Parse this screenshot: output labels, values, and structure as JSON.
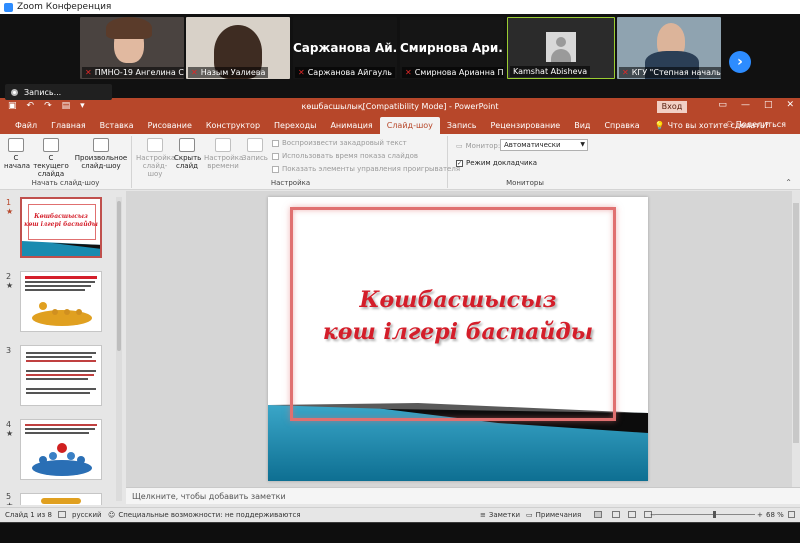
{
  "zoom": {
    "title": "Zoom Конференция",
    "recording_label": "Запись...",
    "participants": [
      {
        "name": "ПМНО-19 Ангелина С..."
      },
      {
        "name": "Назым Уалиева"
      },
      {
        "name": "Саржанова Айгауль",
        "display": "Саржанова Ай..."
      },
      {
        "name": "Смирнова Арианна П...",
        "display": "Смирнова Ари..."
      },
      {
        "name": "Kamshat Abisheva"
      },
      {
        "name": "КГУ \"Степная началь..."
      }
    ]
  },
  "ppt": {
    "doc_title": "көшбасшылық[Compatibility Mode]  -  PowerPoint",
    "login": "Вход",
    "tabs": [
      "Файл",
      "Главная",
      "Вставка",
      "Рисование",
      "Конструктор",
      "Переходы",
      "Анимация",
      "Слайд-шоу",
      "Запись",
      "Рецензирование",
      "Вид",
      "Справка"
    ],
    "tell_me": "Что вы хотите сделать?",
    "share": "Поделиться",
    "ribbon": {
      "from_start": "С начала",
      "from_current": "С текущего слайда",
      "custom": "Произвольное слайд-шоу",
      "group_start": "Начать слайд-шоу",
      "setup_show": "Настройка слайд-шоу",
      "hide_slide": "Скрыть слайд",
      "rehearse": "Настройка времени",
      "record": "Запись",
      "play_narrations": "Воспроизвести закадровый текст",
      "use_timings": "Использовать время показа слайдов",
      "show_media_controls": "Показать элементы управления проигрывателя",
      "group_setup": "Настройка",
      "monitor_label": "Монитор:",
      "monitor_value": "Автоматически",
      "presenter_view": "Режим докладчика",
      "group_monitors": "Мониторы"
    },
    "slides": [
      {
        "num": "1",
        "star": "★"
      },
      {
        "num": "2",
        "star": "★"
      },
      {
        "num": "3",
        "star": ""
      },
      {
        "num": "4",
        "star": "★"
      },
      {
        "num": "5",
        "star": "★"
      }
    ],
    "slide_title_line1": "Көшбасшысыз",
    "slide_title_line2": "көш ілгері баспайды",
    "notes_placeholder": "Щелкните, чтобы добавить заметки",
    "status": {
      "slide_of": "Слайд 1 из 8",
      "language": "русский",
      "accessibility": "Специальные возможности: не поддерживаются",
      "notes": "Заметки",
      "comments": "Примечания",
      "zoom": "68 %"
    }
  }
}
